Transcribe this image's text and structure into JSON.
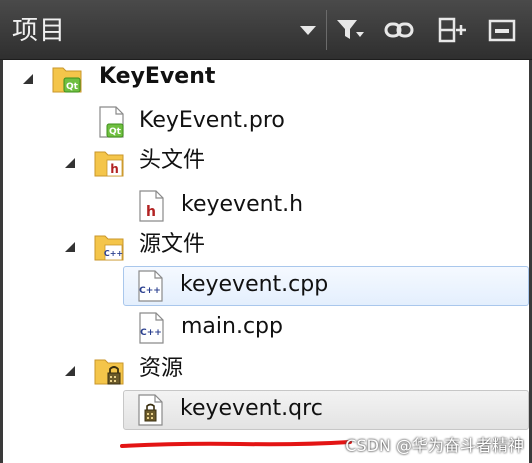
{
  "panel": {
    "title": "项目"
  },
  "toolbar": {
    "icons": [
      "dropdown-icon",
      "filter-icon",
      "link-icon",
      "split-add-icon",
      "close-panel-icon"
    ]
  },
  "tree": {
    "project": {
      "label": "KeyEvent"
    },
    "pro_file": {
      "label": "KeyEvent.pro"
    },
    "headers_folder": {
      "label": "头文件"
    },
    "header_file": {
      "label": "keyevent.h"
    },
    "sources_folder": {
      "label": "源文件"
    },
    "source_file_1": {
      "label": "keyevent.cpp"
    },
    "source_file_2": {
      "label": "main.cpp"
    },
    "resources_folder": {
      "label": "资源"
    },
    "resource_file": {
      "label": "keyevent.qrc"
    }
  },
  "watermark": {
    "text": "CSDN @华为奋斗者精神"
  },
  "colors": {
    "header_bg": "#3a3a3a",
    "selection": "#e4effd",
    "annotation": "#e31414",
    "folder": "#f4c54a"
  }
}
